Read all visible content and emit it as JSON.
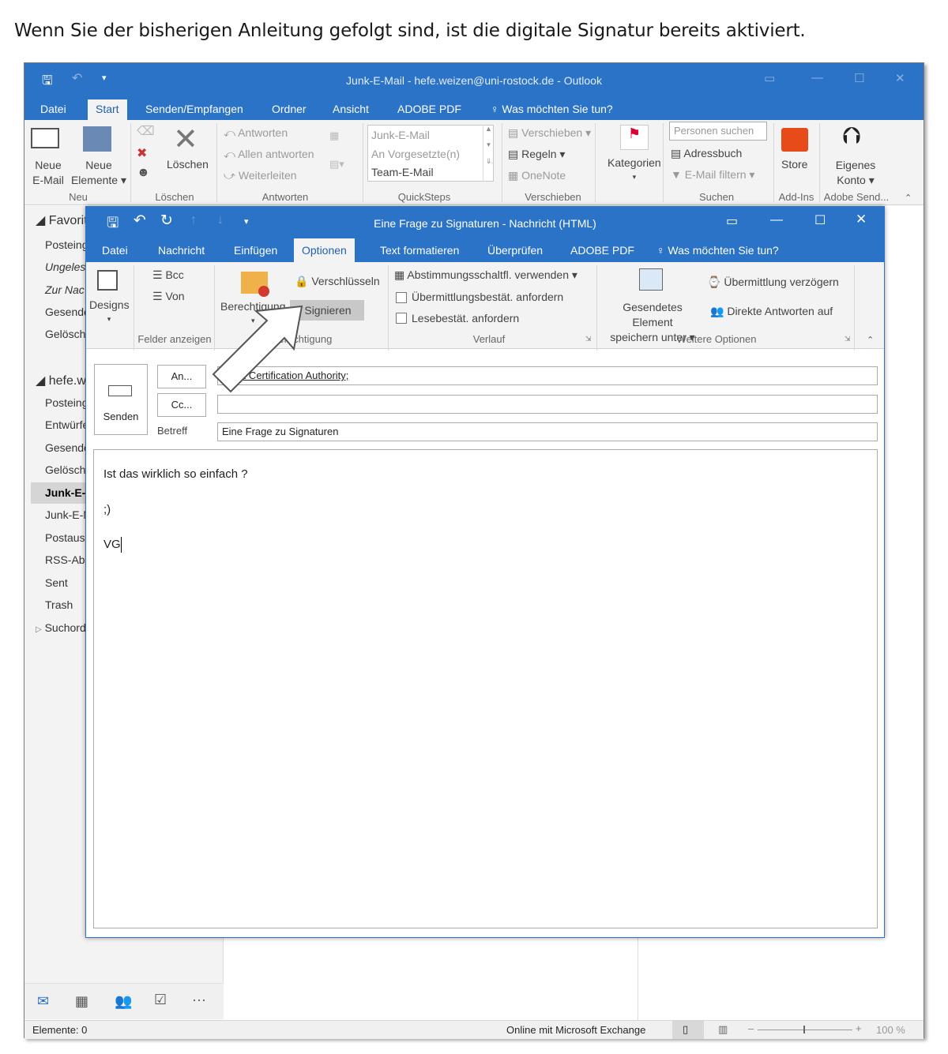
{
  "intro": "Wenn Sie der bisherigen Anleitung gefolgt sind, ist die digitale Signatur bereits aktiviert.",
  "outlook": {
    "title": "Junk-E-Mail - hefe.weizen@uni-rostock.de - Outlook",
    "tabs": [
      "Datei",
      "Start",
      "Senden/Empfangen",
      "Ordner",
      "Ansicht",
      "ADOBE PDF",
      "Was möchten Sie tun?"
    ],
    "ribbon": {
      "neue_email": "Neue",
      "neue_email2": "E-Mail",
      "neue_elemente": "Neue",
      "neue_elemente2": "Elemente",
      "loeschen": "Löschen",
      "antworten": "Antworten",
      "allen_antworten": "Allen antworten",
      "weiterleiten": "Weiterleiten",
      "qs1": "Junk-E-Mail",
      "qs2": "An Vorgesetzte(n)",
      "qs3": "Team-E-Mail",
      "verschieben": "Verschieben",
      "regeln": "Regeln",
      "onenote": "OneNote",
      "kategorien": "Kategorien",
      "personen_suchen": "Personen suchen",
      "adressbuch": "Adressbuch",
      "mail_filtern": "E-Mail filtern",
      "store": "Store",
      "eigenes": "Eigenes",
      "konto": "Konto"
    },
    "groups": [
      "Neu",
      "Löschen",
      "Antworten",
      "QuickSteps",
      "Verschieben",
      "Suchen",
      "Add-Ins",
      "Adobe Send..."
    ],
    "sidebar": {
      "favoriten": "Favorit",
      "fav_items": [
        "Posteing",
        "Ungeles",
        "Zur Nac",
        "Gesende",
        "Gelöscht"
      ],
      "account": "hefe.w",
      "acc_items": [
        "Posteing",
        "Entwürfe",
        "Gesende",
        "Gelöscht",
        "Junk-E-",
        "Junk-E-N",
        "Postaus",
        "RSS-Abo",
        "Sent",
        "Trash",
        "Suchord"
      ]
    },
    "status": {
      "elemente": "Elemente: 0",
      "online": "Online mit Microsoft Exchange",
      "zoom": "100 %"
    }
  },
  "compose": {
    "title": "Eine Frage zu Signaturen - Nachricht (HTML)",
    "tabs": [
      "Datei",
      "Nachricht",
      "Einfügen",
      "Optionen",
      "Text formatieren",
      "Überprüfen",
      "ADOBE PDF",
      "Was möchten Sie tun?"
    ],
    "ribbon": {
      "designs": "Designs",
      "bcc": "Bcc",
      "von": "Von",
      "felder_anzeigen": "Felder anzeigen",
      "berechtigung": "Berechtigung",
      "verschluesseln": "Verschlüsseln",
      "signieren": "Signieren",
      "berechtigung_group": "Berechtigung",
      "abstimmung": "Abstimmungsschaltfl. verwenden",
      "uebermittlung": "Übermittlungsbestät. anfordern",
      "lesebest": "Lesebestät. anfordern",
      "verlauf": "Verlauf",
      "gesendetes1": "Gesendetes Element",
      "gesendetes2": "speichern unter",
      "verzoegern": "Übermittlung verzögern",
      "direkte": "Direkte Antworten auf",
      "weitere": "Weitere Optionen"
    },
    "senden": "Senden",
    "an": "An...",
    "cc": "Cc...",
    "betreff_label": "Betreff",
    "to_value": "ITMZ Certification Authority;",
    "betreff_value": "Eine Frage zu Signaturen",
    "body": [
      "Ist das wirklich so einfach ?",
      ";)",
      "VG"
    ]
  }
}
